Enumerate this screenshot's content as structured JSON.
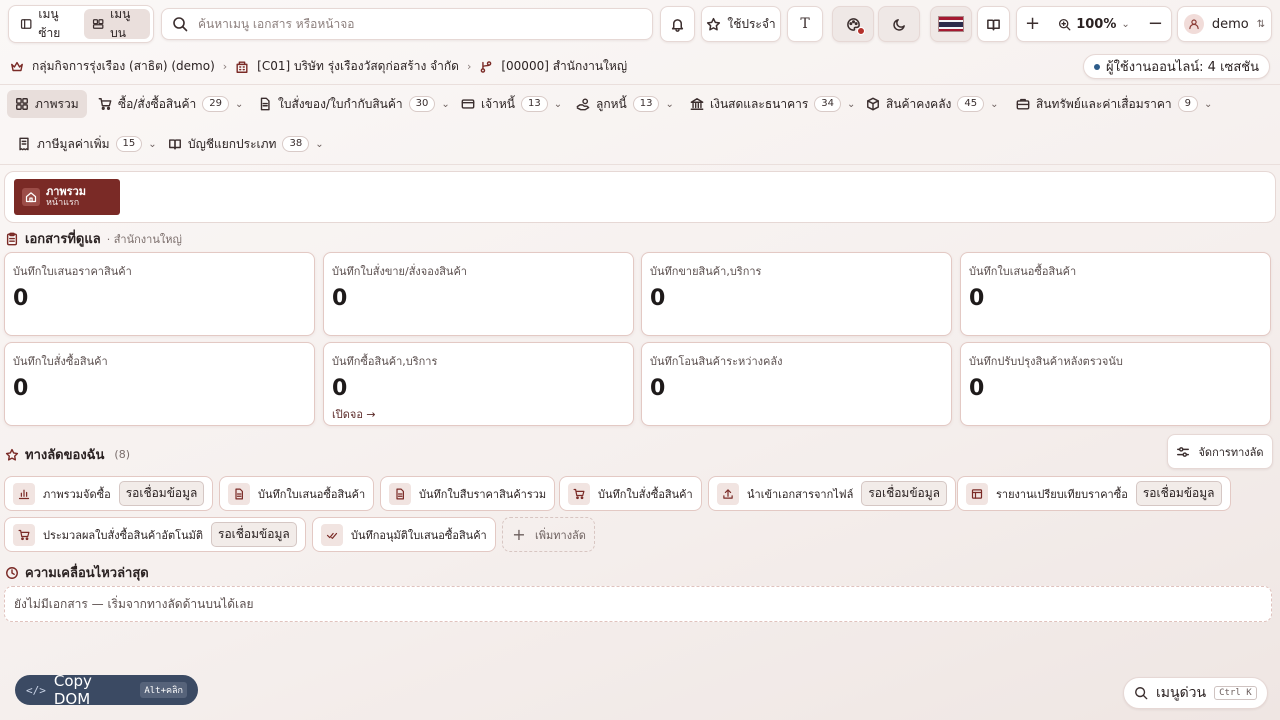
{
  "topbar": {
    "menu_left": "เมนูซ้าย",
    "menu_top": "เมนูบน",
    "search_placeholder": "ค้นหาเมนู เอกสาร หรือหน้าจอ",
    "use_label": "ใช้ประจำ",
    "font_label": "T",
    "zoom": "100%",
    "user": "demo"
  },
  "breadcrumb": {
    "group": "กลุ่มกิจการรุ่งเรือง (สาธิต) (demo)",
    "company": "[C01] บริษัท รุ่งเรืองวัสดุก่อสร้าง จำกัด",
    "branch": "[00000] สำนักงานใหญ่"
  },
  "online": "ผู้ใช้งานออนไลน์: 4 เซสชัน",
  "menu": [
    {
      "label": "ภาพรวม",
      "count": ""
    },
    {
      "label": "ซื้อ/สั่งซื้อสินค้า",
      "count": "29"
    },
    {
      "label": "ใบสั่งของ/ใบกำกับสินค้า",
      "count": "30"
    },
    {
      "label": "เจ้าหนี้",
      "count": "13"
    },
    {
      "label": "ลูกหนี้",
      "count": "13"
    },
    {
      "label": "เงินสดและธนาคาร",
      "count": "34"
    },
    {
      "label": "สินค้าคงคลัง",
      "count": "45"
    },
    {
      "label": "สินทรัพย์และค่าเสื่อมราคา",
      "count": "9"
    },
    {
      "label": "ภาษีมูลค่าเพิ่ม",
      "count": "15"
    },
    {
      "label": "บัญชีแยกประเภท",
      "count": "38"
    }
  ],
  "home_tab": {
    "title": "ภาพรวม",
    "subtitle": "หน้าแรก"
  },
  "docs": {
    "title": "เอกสารที่ดูแล",
    "subtitle": "· สำนักงานใหญ่",
    "cards": [
      {
        "label": "บันทึกใบเสนอราคาสินค้า",
        "value": "0",
        "link": ""
      },
      {
        "label": "บันทึกใบสั่งขาย/สั่งจองสินค้า",
        "value": "0",
        "link": ""
      },
      {
        "label": "บันทึกขายสินค้า,บริการ",
        "value": "0",
        "link": ""
      },
      {
        "label": "บันทึกใบเสนอซื้อสินค้า",
        "value": "0",
        "link": ""
      },
      {
        "label": "บันทึกใบสั่งซื้อสินค้า",
        "value": "0",
        "link": ""
      },
      {
        "label": "บันทึกซื้อสินค้า,บริการ",
        "value": "0",
        "link": "เปิดจอ →"
      },
      {
        "label": "บันทึกโอนสินค้าระหว่างคลัง",
        "value": "0",
        "link": ""
      },
      {
        "label": "บันทึกปรับปรุงสินค้าหลังตรวจนับ",
        "value": "0",
        "link": ""
      }
    ]
  },
  "shortcuts": {
    "title": "ทางลัดของฉัน",
    "count": "(8)",
    "manage": "จัดการทางลัด",
    "items": [
      {
        "label": "ภาพรวมจัดซื้อ",
        "tag": "รอเชื่อมข้อมูล",
        "icon": "chart-icon"
      },
      {
        "label": "บันทึกใบเสนอซื้อสินค้า",
        "tag": "",
        "icon": "doc-icon"
      },
      {
        "label": "บันทึกใบสืบราคาสินค้ารวม",
        "tag": "",
        "icon": "doc-icon"
      },
      {
        "label": "บันทึกใบสั่งซื้อสินค้า",
        "tag": "",
        "icon": "cart-icon"
      },
      {
        "label": "นำเข้าเอกสารจากไฟล์",
        "tag": "รอเชื่อมข้อมูล",
        "icon": "upload-icon"
      },
      {
        "label": "รายงานเปรียบเทียบราคาซื้อ",
        "tag": "รอเชื่อมข้อมูล",
        "icon": "table-icon"
      },
      {
        "label": "ประมวลผลใบสั่งซื้อสินค้าอัตโนมัติ",
        "tag": "รอเชื่อมข้อมูล",
        "icon": "cart-icon"
      },
      {
        "label": "บันทึกอนุมัติใบเสนอซื้อสินค้า",
        "tag": "",
        "icon": "check-icon"
      }
    ],
    "add": "เพิ่มทางลัด"
  },
  "recent": {
    "title": "ความเคลื่อนไหวล่าสุด",
    "empty": "ยังไม่มีเอกสาร — เริ่มจากทางลัดด้านบนได้เลย"
  },
  "copy_dom": {
    "label": "Copy DOM",
    "kbd": "Alt+คลิก"
  },
  "quick_menu": {
    "label": "เมนูด่วน",
    "kbd": "Ctrl K"
  },
  "colors": {
    "accent": "#7a2a26",
    "border": "#e3c9c4",
    "online_dot": "#2d5c8a"
  }
}
